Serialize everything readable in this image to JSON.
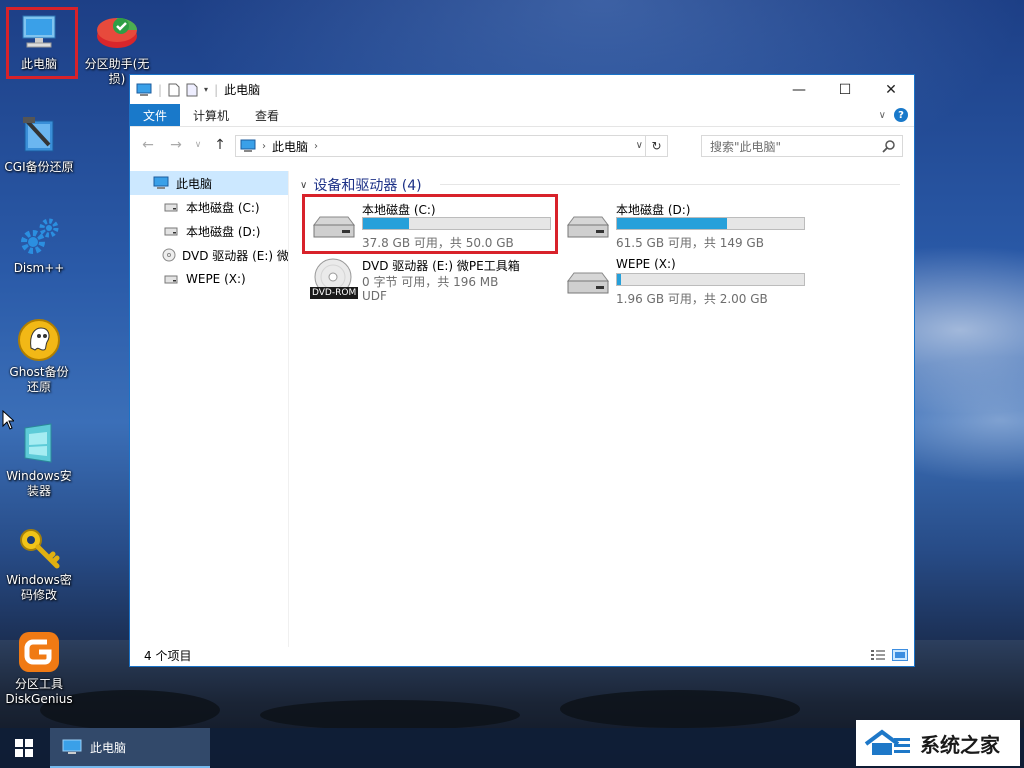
{
  "desktop": {
    "icons": [
      {
        "label": "此电脑",
        "icon": "computer-icon"
      },
      {
        "label": "分区助手(无损)",
        "icon": "partition-assistant-icon"
      },
      {
        "label": "CGI备份还原",
        "icon": "cgi-backup-icon"
      },
      {
        "label": "Dism++",
        "icon": "gear-icon"
      },
      {
        "label": "Ghost备份还原",
        "icon": "ghost-icon"
      },
      {
        "label": "Windows安装器",
        "icon": "windows-installer-icon"
      },
      {
        "label": "Windows密码修改",
        "icon": "key-icon"
      },
      {
        "label": "分区工具DiskGenius",
        "icon": "diskgenius-icon"
      }
    ]
  },
  "window": {
    "title": "此电脑",
    "ribbon_tabs": [
      "文件",
      "计算机",
      "查看"
    ],
    "address": "此电脑",
    "search_placeholder": "搜索\"此电脑\"",
    "nav": [
      {
        "label": "此电脑",
        "icon": "computer-icon"
      },
      {
        "label": "本地磁盘 (C:)",
        "icon": "drive-icon"
      },
      {
        "label": "本地磁盘 (D:)",
        "icon": "drive-icon"
      },
      {
        "label": "DVD 驱动器 (E:) 微",
        "icon": "dvd-icon"
      },
      {
        "label": "WEPE (X:)",
        "icon": "drive-icon"
      }
    ],
    "group_title": "设备和驱动器 (4)",
    "drives": [
      {
        "name": "本地磁盘 (C:)",
        "space": "37.8 GB 可用，共 50.0 GB",
        "used_fraction": 0.244
      },
      {
        "name": "本地磁盘 (D:)",
        "space": "61.5 GB 可用，共 149 GB",
        "used_fraction": 0.587
      },
      {
        "name": "DVD 驱动器 (E:) 微PE工具箱",
        "space": "0 字节 可用，共 196 MB",
        "fs": "UDF",
        "badge": "DVD-ROM"
      },
      {
        "name": "WEPE (X:)",
        "space": "1.96 GB 可用，共 2.00 GB",
        "used_fraction": 0.02
      }
    ],
    "status": "4 个项目"
  },
  "taskbar": {
    "active_item": "此电脑"
  },
  "watermark": {
    "text": "系统之家"
  },
  "colors": {
    "accent": "#1979ca",
    "highlight_box": "#d8222a",
    "bar_fill": "#26a0da"
  }
}
